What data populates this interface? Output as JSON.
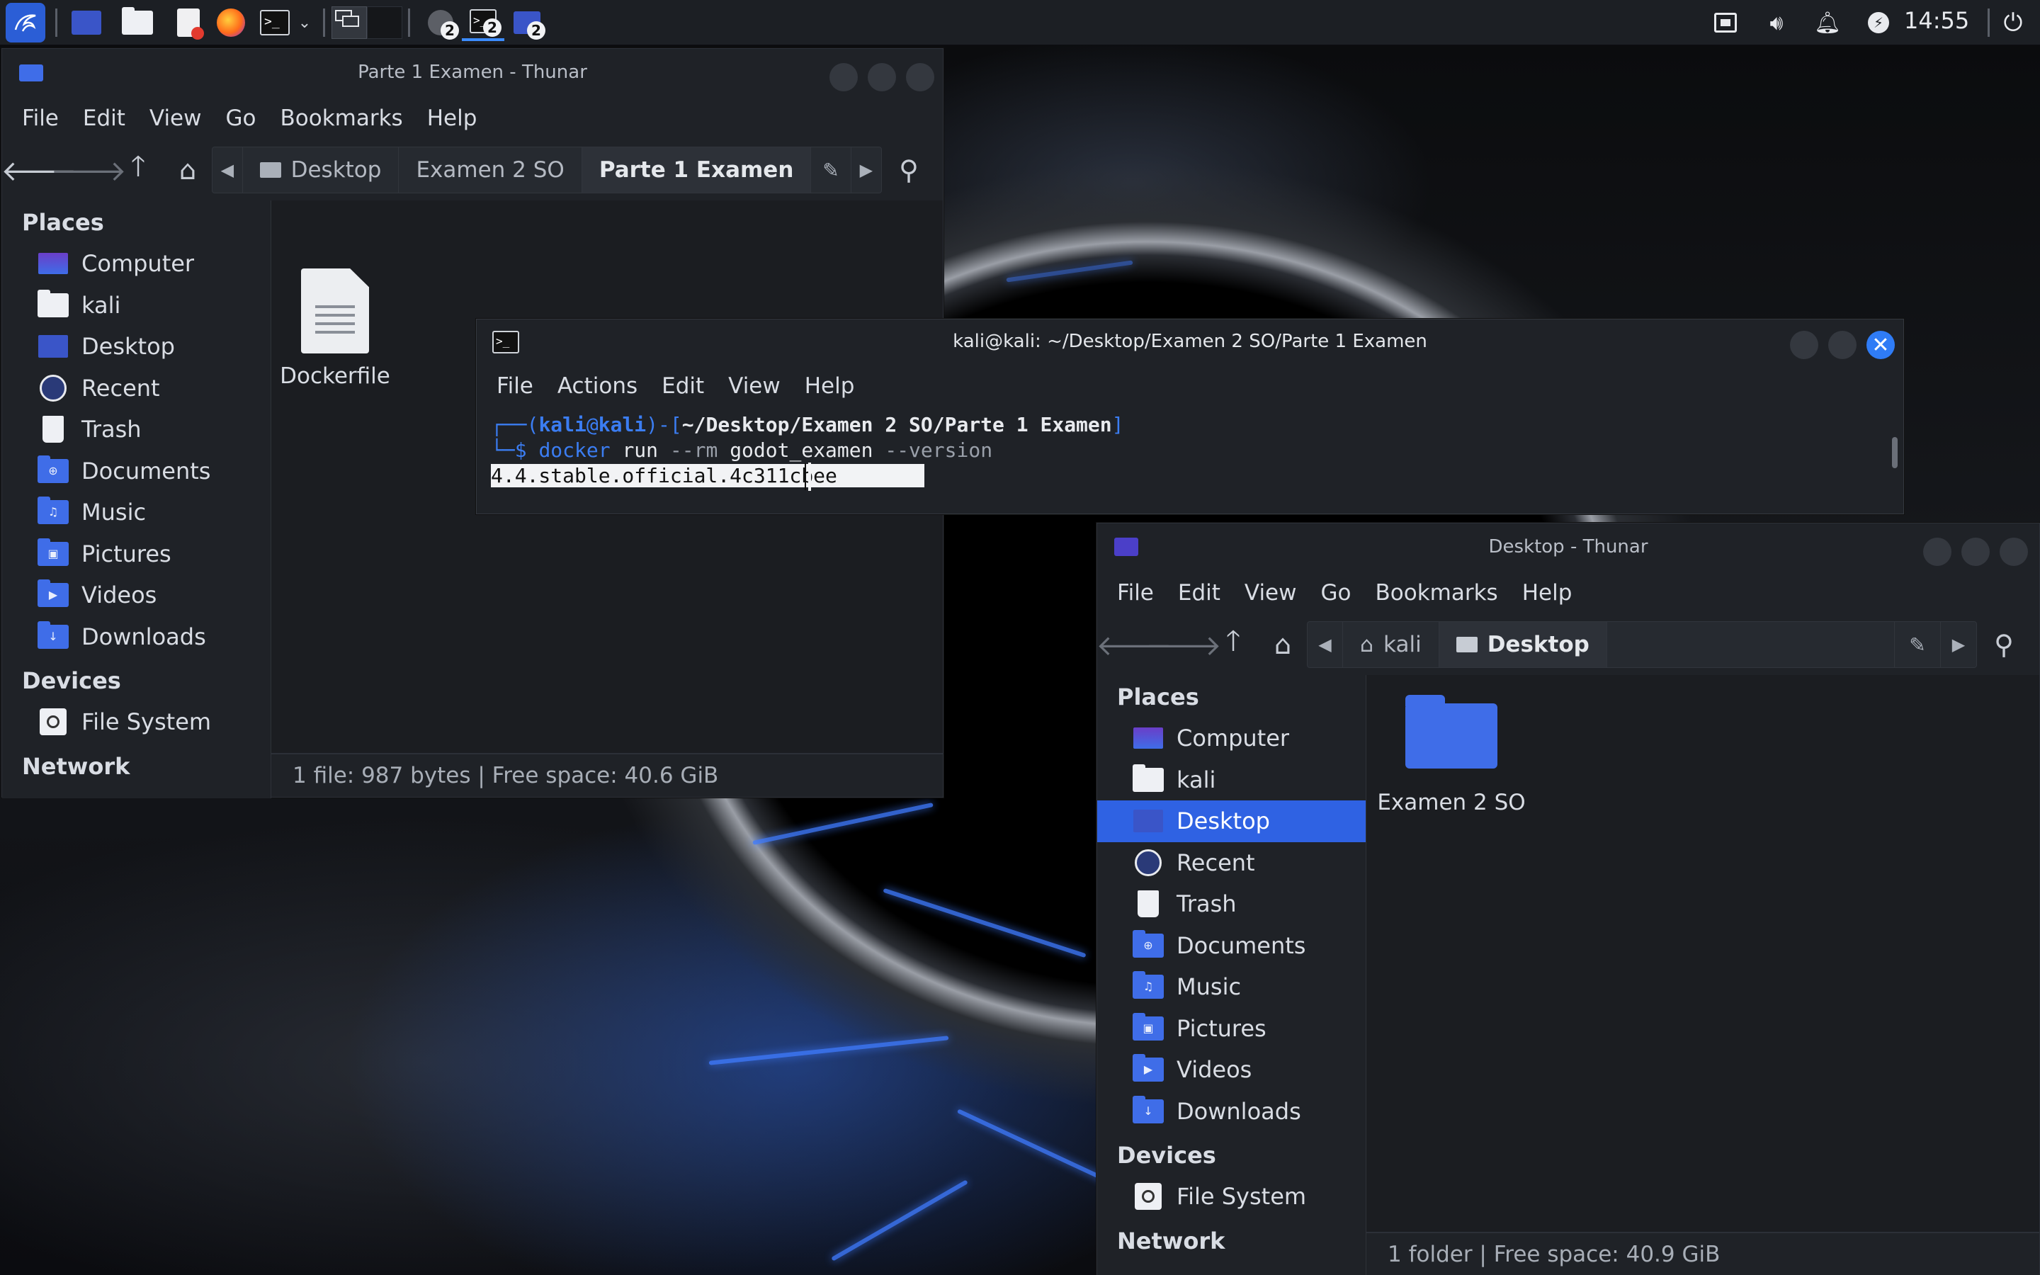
{
  "panel": {
    "clock": "14:55",
    "task_badges": [
      "2",
      "2",
      "2"
    ]
  },
  "thunar1": {
    "title": "Parte 1 Examen - Thunar",
    "menu": [
      "File",
      "Edit",
      "View",
      "Go",
      "Bookmarks",
      "Help"
    ],
    "breadcrumbs": [
      "Desktop",
      "Examen 2 SO",
      "Parte 1 Examen"
    ],
    "places_header": "Places",
    "places": [
      "Computer",
      "kali",
      "Desktop",
      "Recent",
      "Trash",
      "Documents",
      "Music",
      "Pictures",
      "Videos",
      "Downloads"
    ],
    "devices_header": "Devices",
    "devices": [
      "File System"
    ],
    "network_header": "Network",
    "files": [
      "Dockerfile"
    ],
    "status": "1 file: 987 bytes  |  Free space: 40.6 GiB"
  },
  "terminal": {
    "title": "kali@kali: ~/Desktop/Examen 2 SO/Parte 1 Examen",
    "menu": [
      "File",
      "Actions",
      "Edit",
      "View",
      "Help"
    ],
    "prompt_user": "kali",
    "prompt_at": "@",
    "prompt_host": "kali",
    "prompt_path": "~/Desktop/Examen 2 SO/Parte 1 Examen",
    "cmd_docker": "docker",
    "cmd_run": "run",
    "cmd_rm": "--rm",
    "cmd_image": "godot_examen",
    "cmd_version": "--version",
    "output": "4.4.stable.official.4c311cbee"
  },
  "thunar2": {
    "title": "Desktop - Thunar",
    "menu": [
      "File",
      "Edit",
      "View",
      "Go",
      "Bookmarks",
      "Help"
    ],
    "breadcrumbs": [
      "kali",
      "Desktop"
    ],
    "places_header": "Places",
    "places": [
      "Computer",
      "kali",
      "Desktop",
      "Recent",
      "Trash",
      "Documents",
      "Music",
      "Pictures",
      "Videos",
      "Downloads"
    ],
    "selected_place": "Desktop",
    "devices_header": "Devices",
    "devices": [
      "File System"
    ],
    "network_header": "Network",
    "files": [
      "Examen 2 SO"
    ],
    "status": "1 folder  |  Free space: 40.9 GiB"
  },
  "colors": {
    "accent": "#2f62e3",
    "prompt_blue": "#3b7df2",
    "window_bg": "#1f2227",
    "panel_bg": "#1c1f24"
  }
}
